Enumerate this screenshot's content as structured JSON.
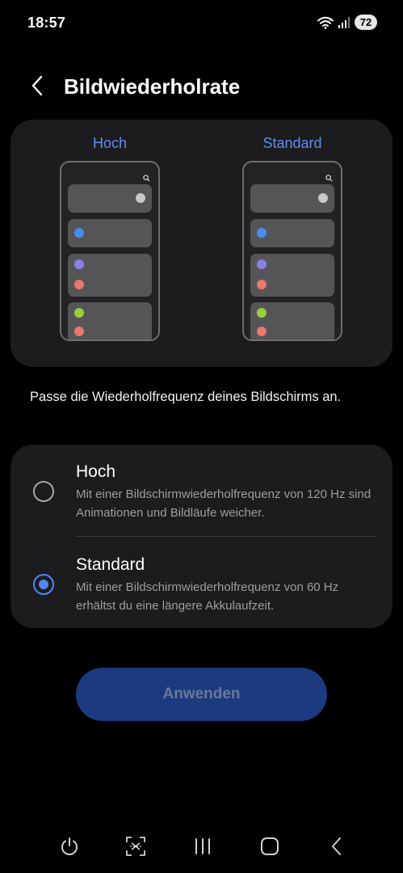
{
  "status_bar": {
    "time": "18:57",
    "battery": "72"
  },
  "header": {
    "title": "Bildwiederholrate"
  },
  "preview": {
    "high_label": "Hoch",
    "standard_label": "Standard",
    "dot_colors": {
      "row1": "#c8c8c8",
      "row2": "#4a8df0",
      "row3a": "#8a7fe6",
      "row3b": "#e8786a",
      "row4a": "#9ccd3c",
      "row4b": "#e8786a"
    }
  },
  "description": "Passe die Wiederholfrequenz deines Bildschirms an.",
  "options": [
    {
      "title": "Hoch",
      "description": "Mit einer Bildschirmwiederholfrequenz von 120 Hz sind Animationen und Bildläufe weicher.",
      "selected": false
    },
    {
      "title": "Standard",
      "description": "Mit einer Bildschirmwiederholfrequenz von 60 Hz erhältst du eine längere Akkulaufzeit.",
      "selected": true
    }
  ],
  "apply_button": {
    "label": "Anwenden",
    "enabled": false
  },
  "colors": {
    "accent": "#4f86f7",
    "card_background": "#1c1c1e",
    "button_background": "#1c3a7f"
  },
  "icons": {
    "back": "chevron-left-icon",
    "wifi": "wifi-icon",
    "signal": "signal-icon",
    "search": "search-icon",
    "nav_power": "power-icon",
    "nav_capture": "screen-capture-icon",
    "nav_recents": "recent-apps-icon",
    "nav_home": "home-icon",
    "nav_back": "back-icon"
  }
}
